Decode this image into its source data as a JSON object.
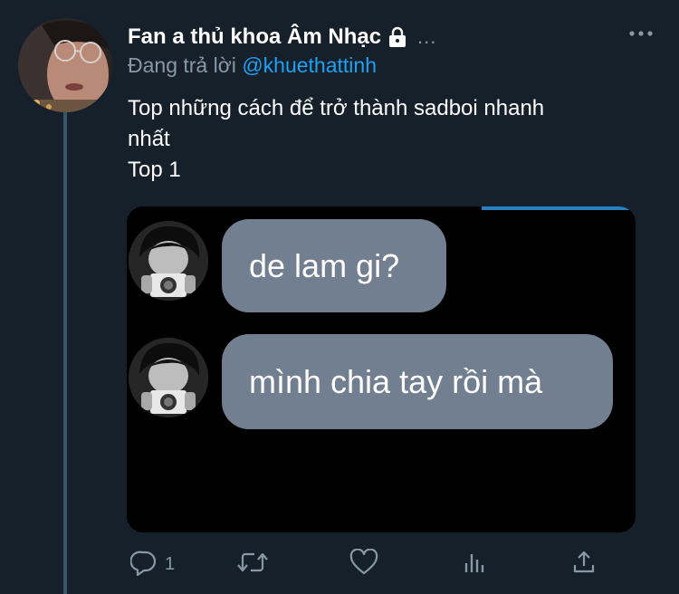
{
  "tweet": {
    "display_name": "Fan a thủ khoa Âm Nhạc",
    "name_overflow": "...",
    "replying_prefix": "Đang trả lời",
    "replying_handle": "@khuethattinh",
    "text_lines": [
      "Top những cách để trở thành sadboi nhanh",
      "nhất",
      "Top 1"
    ],
    "icons": {
      "lock": "lock-icon",
      "more": "more-horizontal-icon"
    }
  },
  "media": {
    "messages": [
      {
        "text": "de lam gi?"
      },
      {
        "text": "mình chia tay rồi mà"
      }
    ]
  },
  "actions": {
    "reply_count": "1",
    "icons": [
      "reply-icon",
      "retweet-icon",
      "like-icon",
      "analytics-icon",
      "share-icon"
    ]
  },
  "colors": {
    "background": "#15202b",
    "text_primary": "#ffffff",
    "text_secondary": "#8899a6",
    "link": "#1da1f2",
    "bubble": "#717f91",
    "media_bg": "#000000",
    "thread_line": "#3d5466"
  }
}
